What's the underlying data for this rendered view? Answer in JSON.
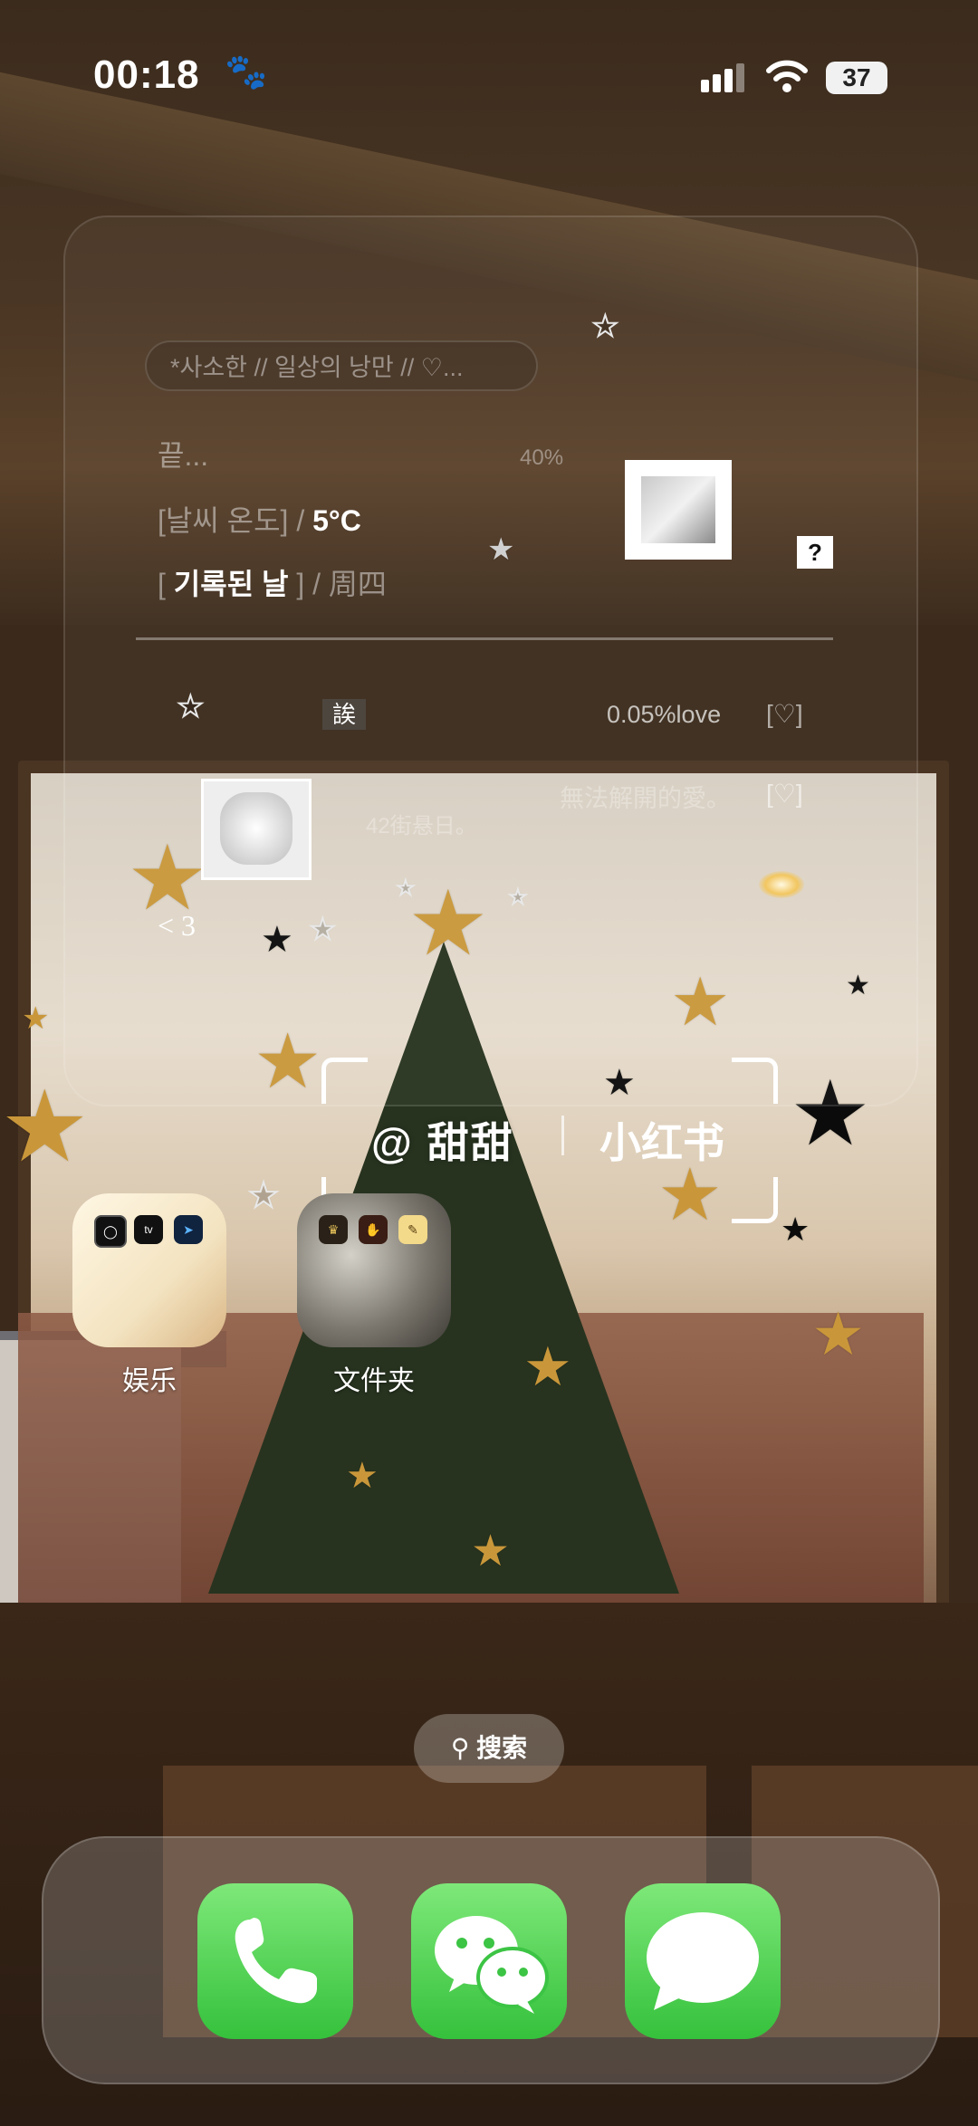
{
  "status_bar": {
    "time": "00:18",
    "battery": "37",
    "icons": [
      "paw-icon",
      "signal-icon",
      "wifi-icon",
      "battery-icon"
    ]
  },
  "widget": {
    "pill_text": "*사소한 // 일상의 낭만 // ♡...",
    "end_text": "끝...",
    "percent": "40%",
    "weather_label": "[날씨 온도]",
    "weather_sep": " / ",
    "weather_value": "5°C",
    "date_label_open": "[ ",
    "date_label": "기록된 날",
    "date_label_close": " ]",
    "date_sep": " / ",
    "date_value": "周四",
    "question": "?",
    "kanji": "誒",
    "love_text": "0.05%love",
    "heart_bracket": "[♡]",
    "cn_phrase": "無法解開的愛。",
    "street_text": "42街悬日。",
    "less_three": "< 3"
  },
  "watermark": {
    "handle": "@ 甜甜",
    "site": "小红书"
  },
  "folders": [
    {
      "label": "娱乐",
      "apps": [
        "circle-app-icon",
        "apple-tv-icon",
        "infuse-icon"
      ]
    },
    {
      "label": "文件夹",
      "apps": [
        "crown-app-icon",
        "nail-app-icon",
        "note-app-icon"
      ]
    }
  ],
  "search": {
    "label": "搜索"
  },
  "dock": {
    "apps": [
      "phone-icon",
      "wechat-icon",
      "messages-icon"
    ],
    "accent": "#4cd45a"
  }
}
